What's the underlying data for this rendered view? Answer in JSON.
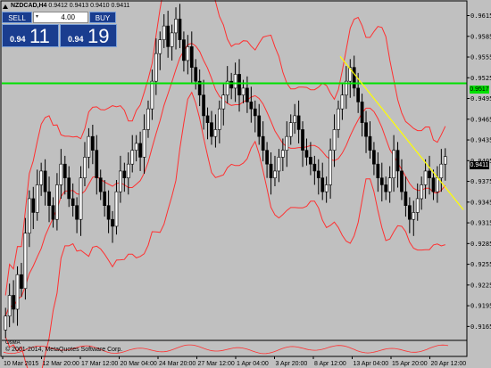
{
  "title": {
    "symbol": "NZDCAD,H4",
    "ohlc": "0.9412 0.9413 0.9410 0.9411"
  },
  "trade_panel": {
    "sell_label": "SELL",
    "buy_label": "BUY",
    "lot_value": "4.00",
    "bid_prefix": "0.94",
    "bid_big": "11",
    "ask_prefix": "0.94",
    "ask_big": "19"
  },
  "current_price": "0.9411",
  "level_price": "0.9517",
  "copyright": "© 2001-2014, MetaQuotes Software Corp.",
  "indicator_label": "OsMA",
  "price_axis": [
    "0.9615",
    "0.9585",
    "0.9555",
    "0.9525",
    "0.9495",
    "0.9465",
    "0.9435",
    "0.9405",
    "0.9375",
    "0.9345",
    "0.9315",
    "0.9285",
    "0.9255",
    "0.9225",
    "0.9195",
    "0.9165"
  ],
  "time_axis": [
    "10 Mar 2015",
    "12 Mar 20:00",
    "17 Mar 12:00",
    "20 Mar 04:00",
    "24 Mar 20:00",
    "27 Mar 12:00",
    "1 Apr 04:00",
    "3 Apr 20:00",
    "8 Apr 12:00",
    "13 Apr 04:00",
    "15 Apr 20:00",
    "20 Apr 12:00"
  ],
  "colors": {
    "background": "#c0c0c0",
    "bull": "#ffffff",
    "bear": "#000000",
    "band": "#ff3030",
    "level": "#00e000",
    "trend": "#ffff00"
  },
  "chart_data": {
    "type": "candlestick",
    "symbol": "NZDCAD",
    "timeframe": "H4",
    "ylim": [
      0.915,
      0.9635
    ],
    "horizontal_line": 0.9517,
    "trendline": {
      "from": {
        "x": "8 Apr 12:00",
        "y": 0.9556
      },
      "to": {
        "x": "20 Apr 12:00",
        "y": 0.9334
      }
    },
    "close": [
      0.918,
      0.921,
      0.919,
      0.924,
      0.922,
      0.93,
      0.935,
      0.933,
      0.937,
      0.939,
      0.936,
      0.934,
      0.932,
      0.937,
      0.94,
      0.938,
      0.935,
      0.934,
      0.932,
      0.938,
      0.941,
      0.944,
      0.942,
      0.938,
      0.936,
      0.934,
      0.932,
      0.931,
      0.936,
      0.939,
      0.938,
      0.94,
      0.942,
      0.943,
      0.941,
      0.945,
      0.948,
      0.952,
      0.956,
      0.958,
      0.96,
      0.957,
      0.959,
      0.961,
      0.958,
      0.955,
      0.957,
      0.954,
      0.952,
      0.95,
      0.947,
      0.946,
      0.944,
      0.945,
      0.948,
      0.95,
      0.952,
      0.951,
      0.953,
      0.95,
      0.951,
      0.949,
      0.948,
      0.947,
      0.944,
      0.942,
      0.94,
      0.938,
      0.939,
      0.941,
      0.942,
      0.944,
      0.946,
      0.947,
      0.945,
      0.942,
      0.941,
      0.94,
      0.939,
      0.938,
      0.936,
      0.937,
      0.942,
      0.945,
      0.948,
      0.95,
      0.952,
      0.954,
      0.951,
      0.949,
      0.946,
      0.944,
      0.942,
      0.94,
      0.938,
      0.937,
      0.936,
      0.938,
      0.942,
      0.939,
      0.936,
      0.934,
      0.932,
      0.933,
      0.935,
      0.937,
      0.939,
      0.938,
      0.936,
      0.938,
      0.94,
      0.9411
    ]
  }
}
